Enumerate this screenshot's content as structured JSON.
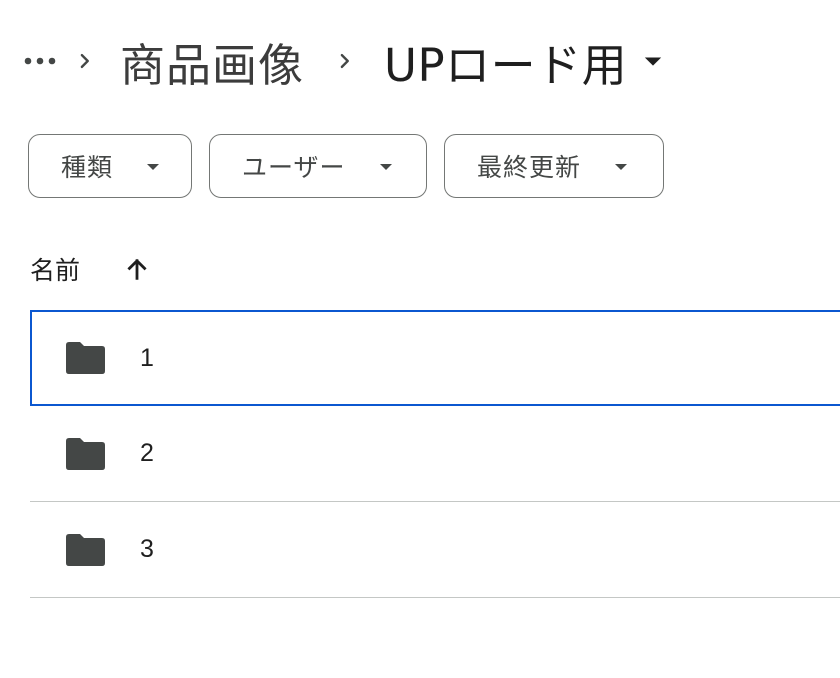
{
  "breadcrumb": {
    "more_label": "…",
    "parent": "商品画像",
    "current": "UPロード用"
  },
  "filters": {
    "type_label": "種類",
    "user_label": "ユーザー",
    "modified_label": "最終更新"
  },
  "sort": {
    "column_label": "名前",
    "direction": "ascending"
  },
  "folders": [
    {
      "name": "1",
      "selected": true
    },
    {
      "name": "2",
      "selected": false
    },
    {
      "name": "3",
      "selected": false
    }
  ],
  "colors": {
    "selection_border": "#0b57d0",
    "folder_icon": "#444746",
    "divider": "#c4c7c5"
  }
}
